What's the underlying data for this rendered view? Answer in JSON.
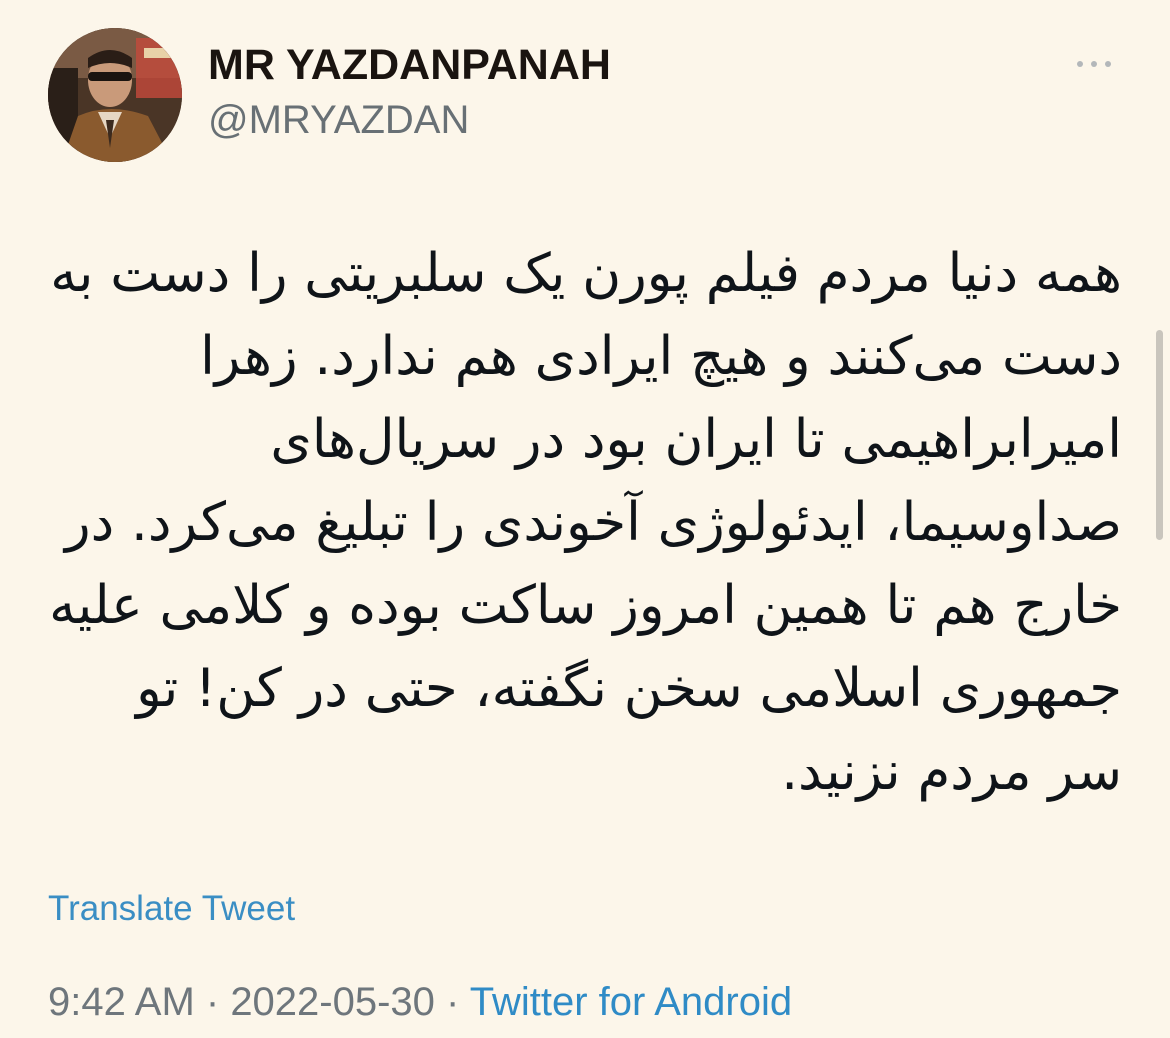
{
  "author": {
    "display_name": "MR YAZDANPANAH",
    "handle": "@MRYAZDAN",
    "avatar_icon": "profile-photo"
  },
  "more_icon": "more-options-icon",
  "tweet": {
    "text": "همه دنیا مردم فیلم پورن یک سلبریتی را دست به دست می‌کنند و هیچ ایرادی هم ندارد. زهرا امیرابراهیمی تا ایران بود در سریال‌های صداوسیما، ایدئولوژی آخوندی را تبلیغ می‌کرد. در خارج هم تا همین امروز ساکت بوده و کلامی علیه جمهوری اسلامی سخن نگفته، حتی در کن! تو سر مردم نزنید.",
    "translate_label": "Translate Tweet",
    "time": "9:42 AM",
    "separator": " · ",
    "date": "2022-05-30",
    "source": "Twitter for Android"
  },
  "colors": {
    "background": "#fcf6ea",
    "link": "#2f8bc6",
    "muted": "#6e767c"
  }
}
